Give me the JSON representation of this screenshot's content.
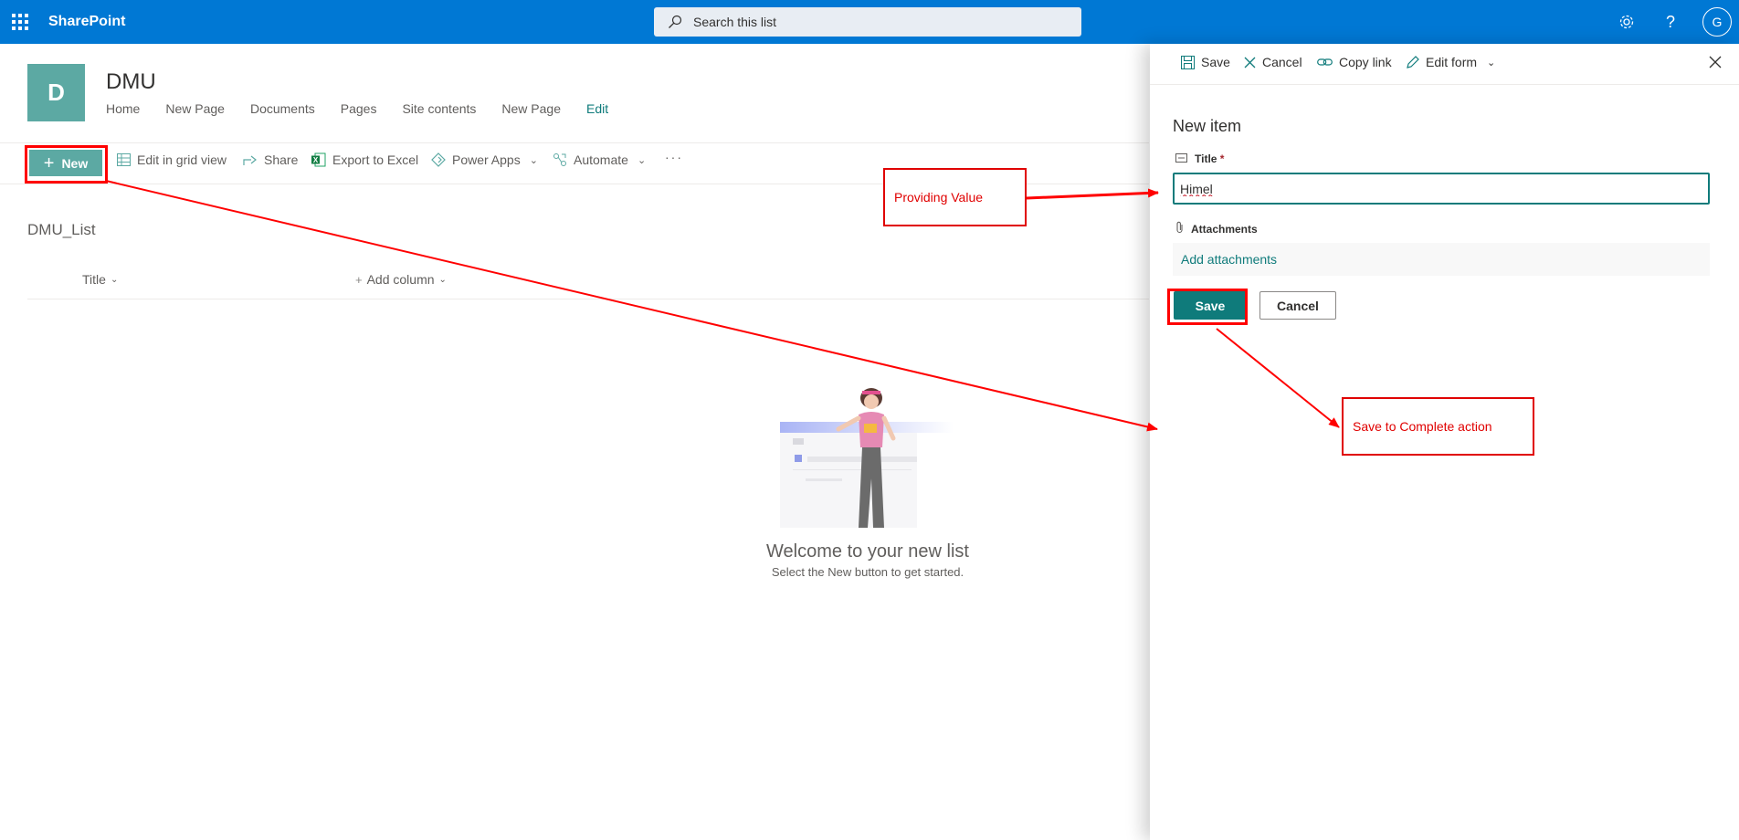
{
  "suitebar": {
    "app_name": "SharePoint",
    "search_placeholder": "Search this list",
    "avatar_initial": "G"
  },
  "site": {
    "logo_letter": "D",
    "title": "DMU",
    "nav": [
      "Home",
      "New Page",
      "Documents",
      "Pages",
      "Site contents",
      "New Page",
      "Edit"
    ]
  },
  "command_bar": {
    "new_label": "New",
    "grid_view_label": "Edit in grid view",
    "share_label": "Share",
    "export_label": "Export to Excel",
    "power_apps_label": "Power Apps",
    "automate_label": "Automate",
    "more_label": "···"
  },
  "list": {
    "name": "DMU_List",
    "columns": [
      "Title",
      "Add column"
    ],
    "empty_title": "Welcome to your new list",
    "empty_subtitle": "Select the New button to get started."
  },
  "panel": {
    "commands": {
      "save": "Save",
      "cancel": "Cancel",
      "copy_link": "Copy link",
      "edit_form": "Edit form"
    },
    "heading": "New item",
    "title_label": "Title",
    "required_mark": "*",
    "title_value": "Himel",
    "attachments_label": "Attachments",
    "add_attachments": "Add attachments",
    "save_button": "Save",
    "cancel_button": "Cancel"
  },
  "annotations": {
    "providing_value": "Providing Value",
    "save_complete": "Save to Complete action"
  },
  "colors": {
    "suitebar": "#0078d4",
    "theme": "#5ca9a3",
    "primary": "#0f7b7b",
    "annotation": "#ff0000"
  }
}
